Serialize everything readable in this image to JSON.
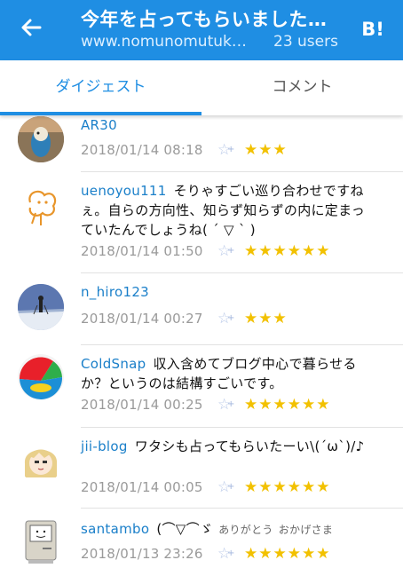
{
  "header": {
    "title": "今年を占ってもらいました…",
    "url": "www.nomunomutuk…",
    "users": "23 users",
    "hatena_label": "B!"
  },
  "tabs": [
    {
      "label": "ダイジェスト",
      "active": true
    },
    {
      "label": "コメント",
      "active": false
    }
  ],
  "accent_color": "#1f8ee3",
  "star_color": "#f2c100",
  "comments": [
    {
      "user": "AR30",
      "text": "",
      "tags": [],
      "time": "2018/01/14 08:18",
      "stars": 3,
      "stars_text": "★★★"
    },
    {
      "user": "uenoyou111",
      "text": "そりゃすごい巡り合わせですねぇ。自らの方向性、知らず知らずの内に定まっていたんでしょうね( ´ ▽ ` )",
      "tags": [],
      "time": "2018/01/14 01:50",
      "stars": 6,
      "stars_text": "★★★★★★"
    },
    {
      "user": "n_hiro123",
      "text": "",
      "tags": [],
      "time": "2018/01/14 00:27",
      "stars": 3,
      "stars_text": "★★★"
    },
    {
      "user": "ColdSnap",
      "text": "収入含めてブログ中心で暮らせるか？というのは結構すごいです。",
      "tags": [],
      "time": "2018/01/14 00:25",
      "stars": 6,
      "stars_text": "★★★★★★"
    },
    {
      "user": "jii-blog",
      "text": "ワタシも占ってもらいたーい\\(´ω`)/♪",
      "tags": [],
      "time": "2018/01/14 00:05",
      "stars": 6,
      "stars_text": "★★★★★★"
    },
    {
      "user": "santambo",
      "text": "(⌒▽⌒ゞ",
      "tags": [
        "ありがとう",
        "おかげさま"
      ],
      "time": "2018/01/13 23:26",
      "stars": 6,
      "stars_text": "★★★★★★"
    }
  ]
}
